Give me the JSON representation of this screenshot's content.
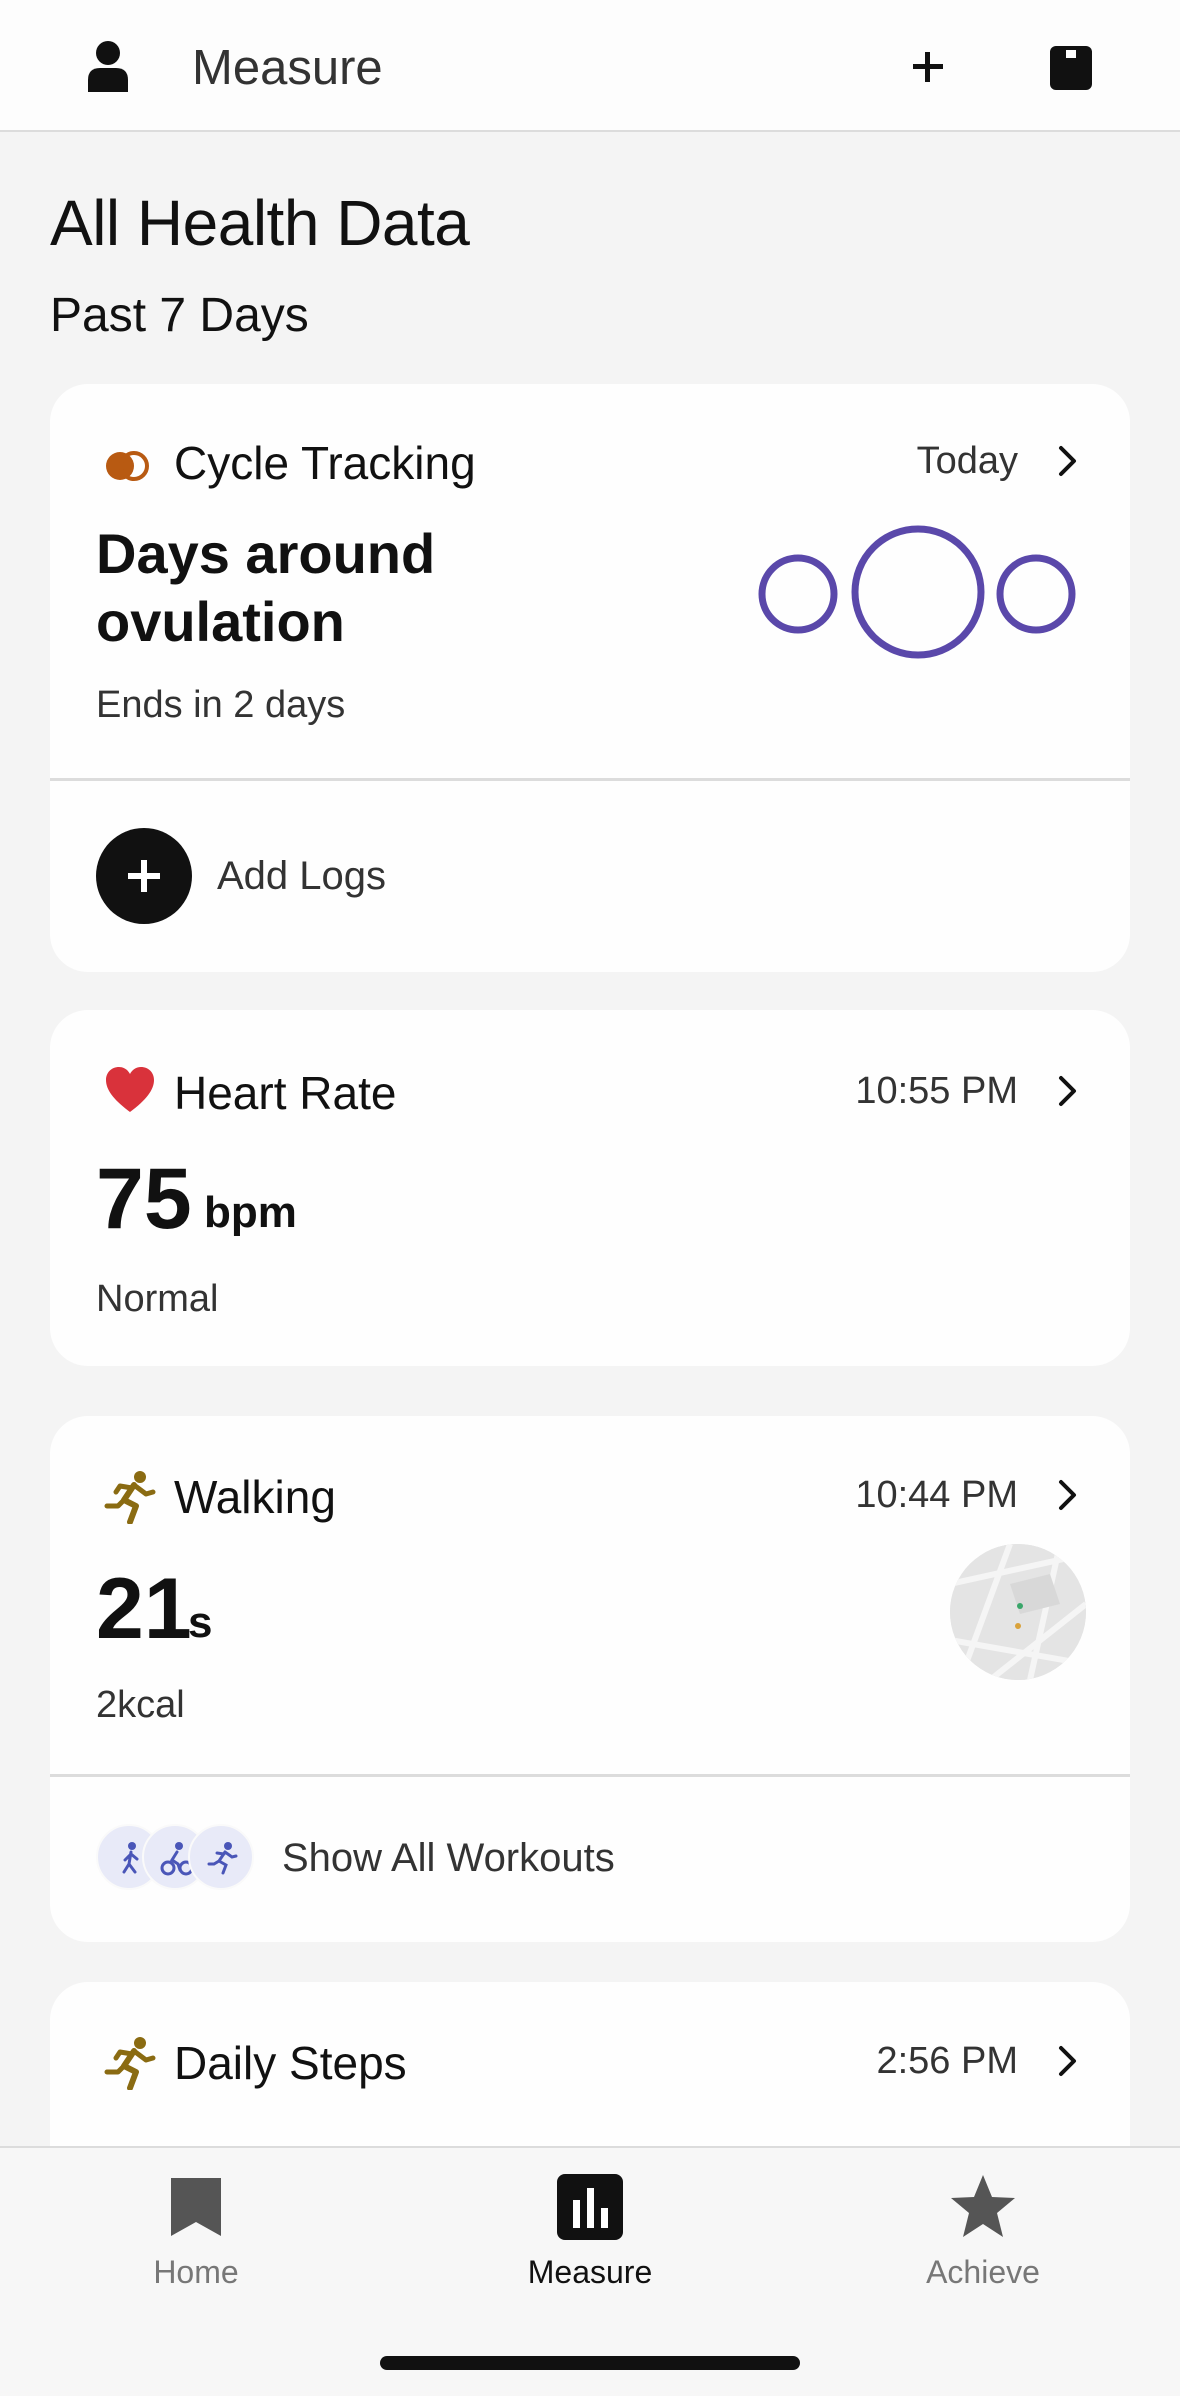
{
  "header": {
    "title": "Measure"
  },
  "page": {
    "title": "All Health Data",
    "subtitle": "Past 7 Days"
  },
  "cards": {
    "cycle": {
      "title": "Cycle Tracking",
      "time": "Today",
      "headline": "Days around ovulation",
      "subtext": "Ends in 2 days",
      "action_label": "Add Logs",
      "icon": "cycle-tracking-icon",
      "ring_color": "#5a48aa"
    },
    "heart": {
      "title": "Heart Rate",
      "time": "10:55 PM",
      "value": "75",
      "unit": "bpm",
      "status": "Normal",
      "icon": "heart-icon",
      "icon_color": "#d9323b"
    },
    "walking": {
      "title": "Walking",
      "time": "10:44 PM",
      "value": "21",
      "unit": "s",
      "subtext": "2kcal",
      "action_label": "Show All Workouts",
      "icon": "walking-icon",
      "icon_color": "#8a6b12"
    },
    "steps": {
      "title": "Daily Steps",
      "time": "2:56 PM",
      "icon": "walking-icon"
    }
  },
  "nav": {
    "tabs": [
      {
        "label": "Home",
        "icon": "bookmark-icon",
        "active": false
      },
      {
        "label": "Measure",
        "icon": "bar-chart-icon",
        "active": true
      },
      {
        "label": "Achieve",
        "icon": "star-icon",
        "active": false
      }
    ]
  }
}
